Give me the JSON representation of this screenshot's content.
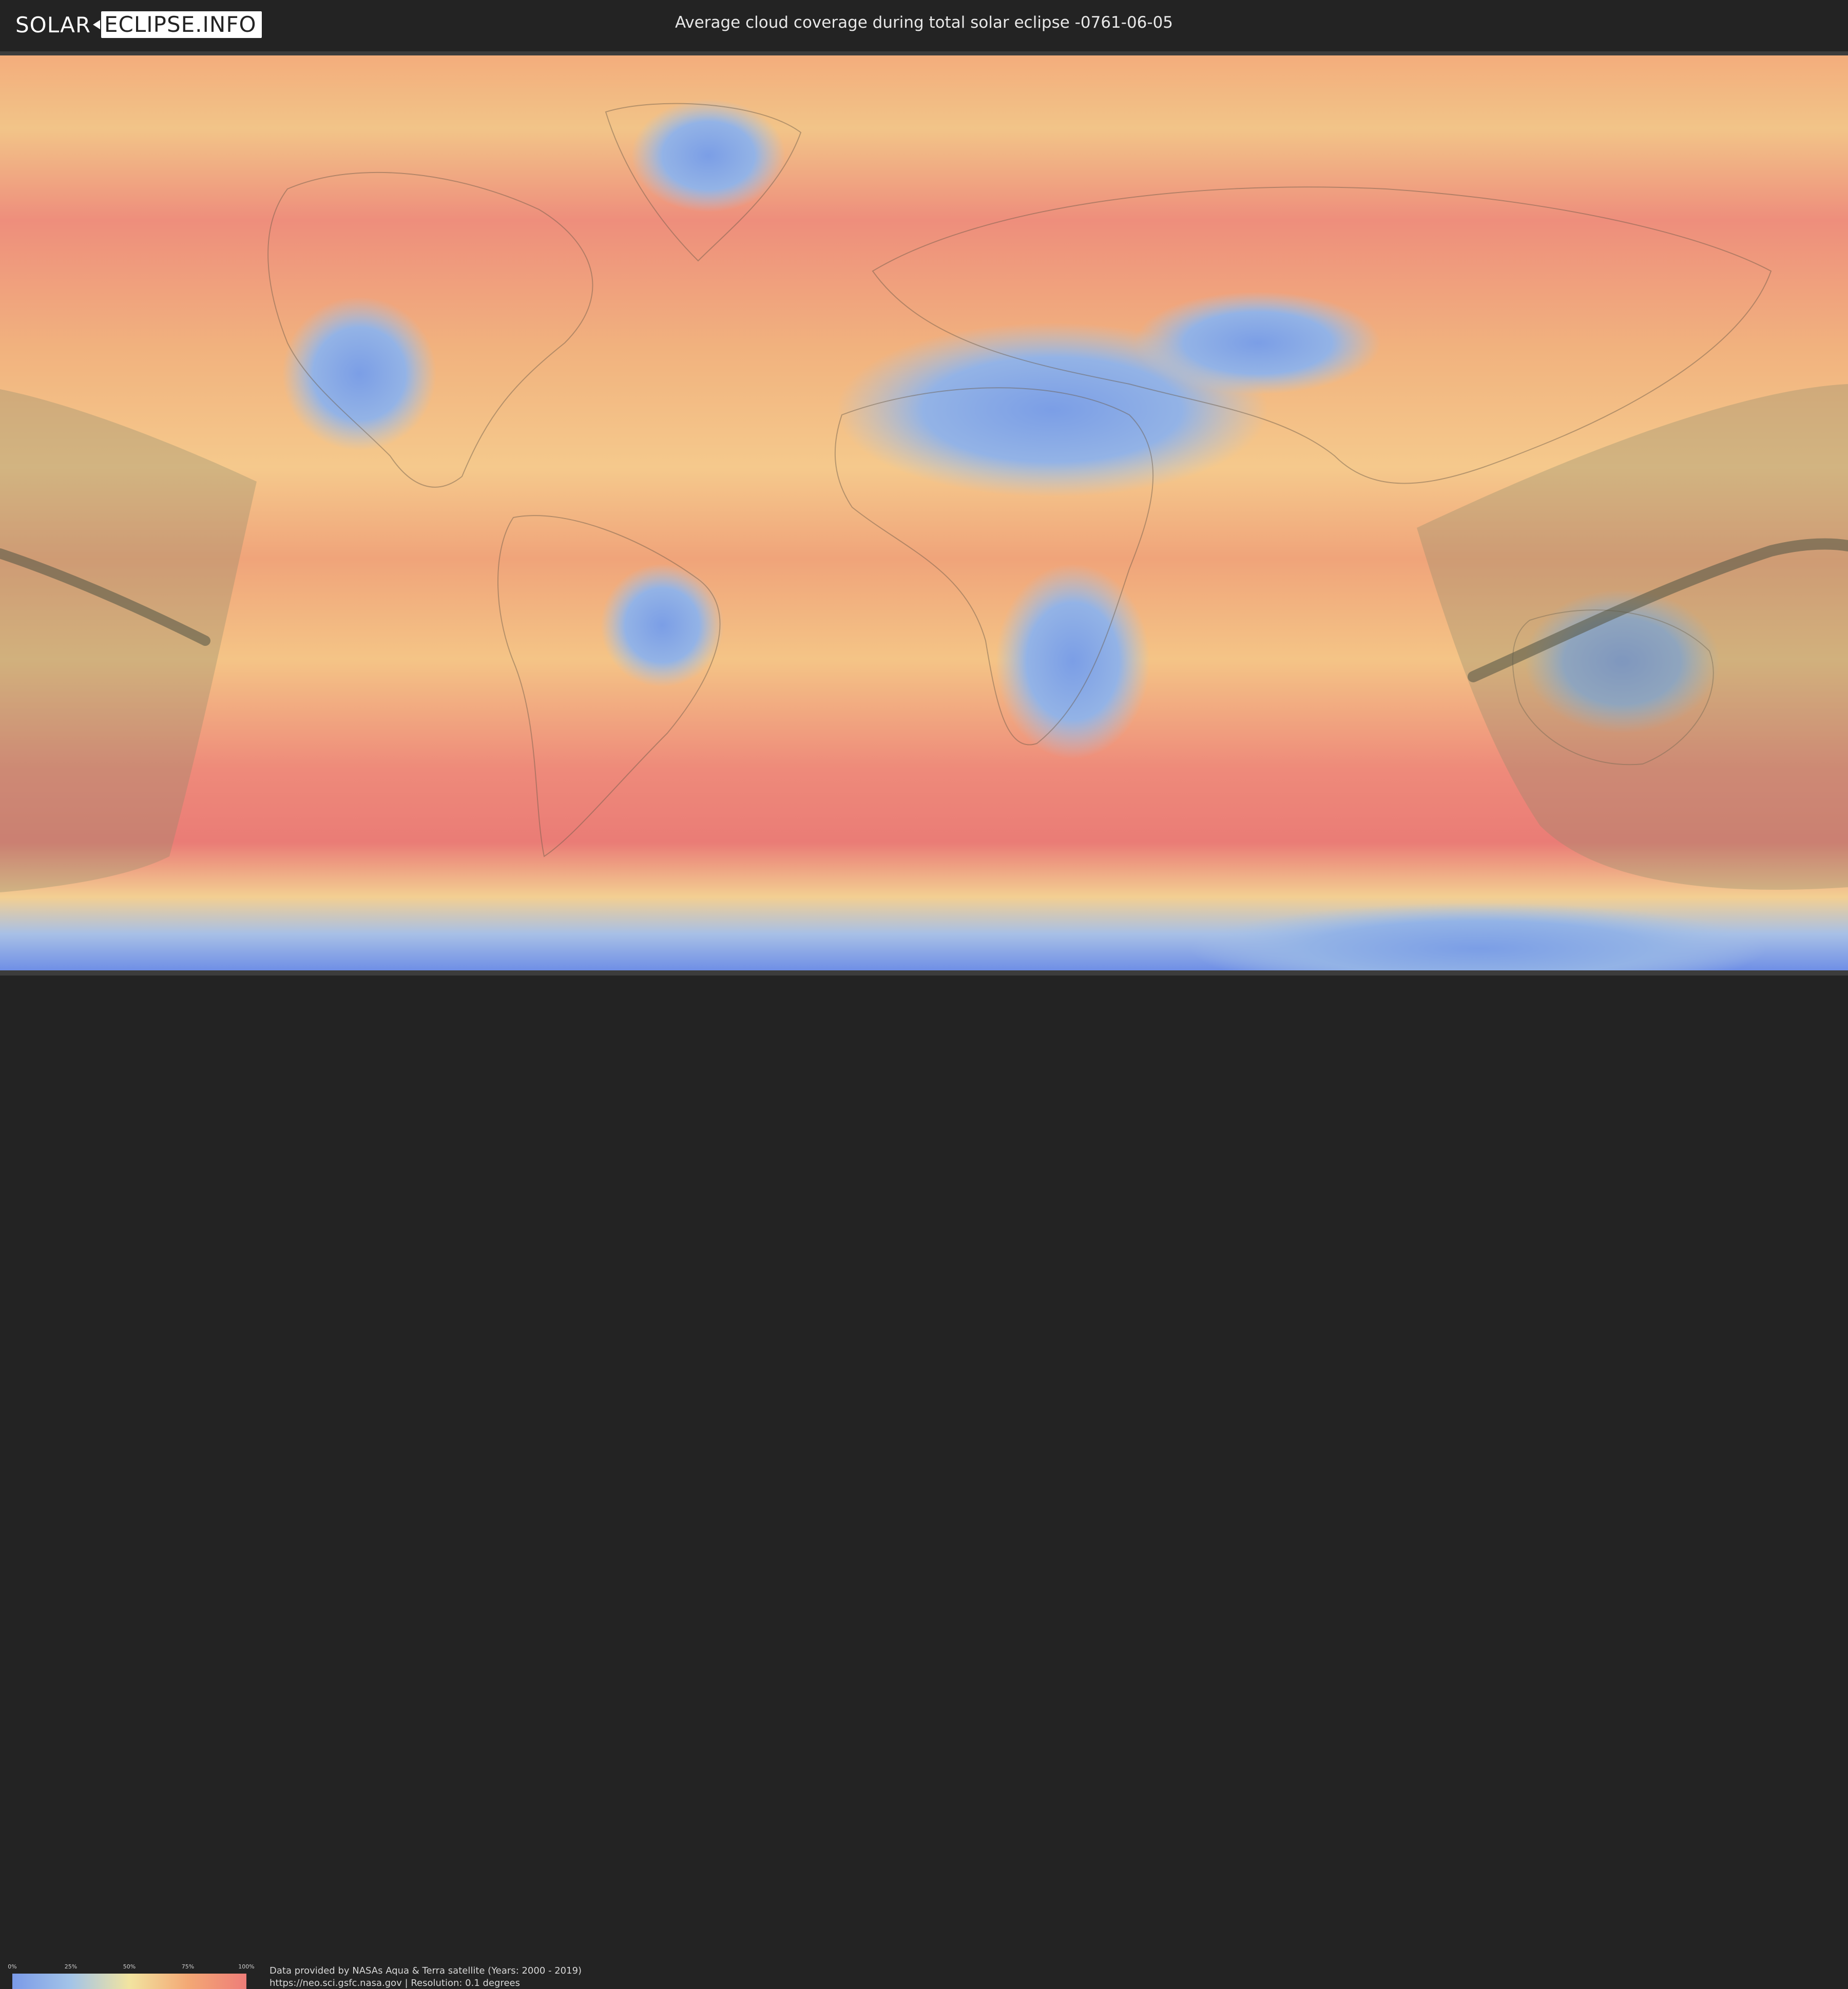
{
  "header": {
    "logo_part1": "SOLAR",
    "logo_part2": "ECLIPSE.INFO",
    "title": "Average cloud coverage during total solar eclipse -0761-06-05"
  },
  "map": {
    "type": "world cloud coverage map (equirectangular)",
    "overlay": "eclipse visibility region and path of totality",
    "colors": {
      "clear": "#7a9ae8",
      "low": "#a3c4e8",
      "mid": "#f2e4a0",
      "high": "#f3a875",
      "overcast": "#ee7d78",
      "eclipse_region": "#8a8a6a",
      "totality_path": "#5a5a48"
    }
  },
  "legend": {
    "ticks": [
      "0%",
      "25%",
      "50%",
      "75%",
      "100%"
    ]
  },
  "credits": {
    "line1": "Data provided by NASAs Aqua & Terra satellite (Years: 2000 - 2019)",
    "line2": "https://neo.sci.gsfc.nasa.gov | Resolution: 0.1 degrees"
  }
}
